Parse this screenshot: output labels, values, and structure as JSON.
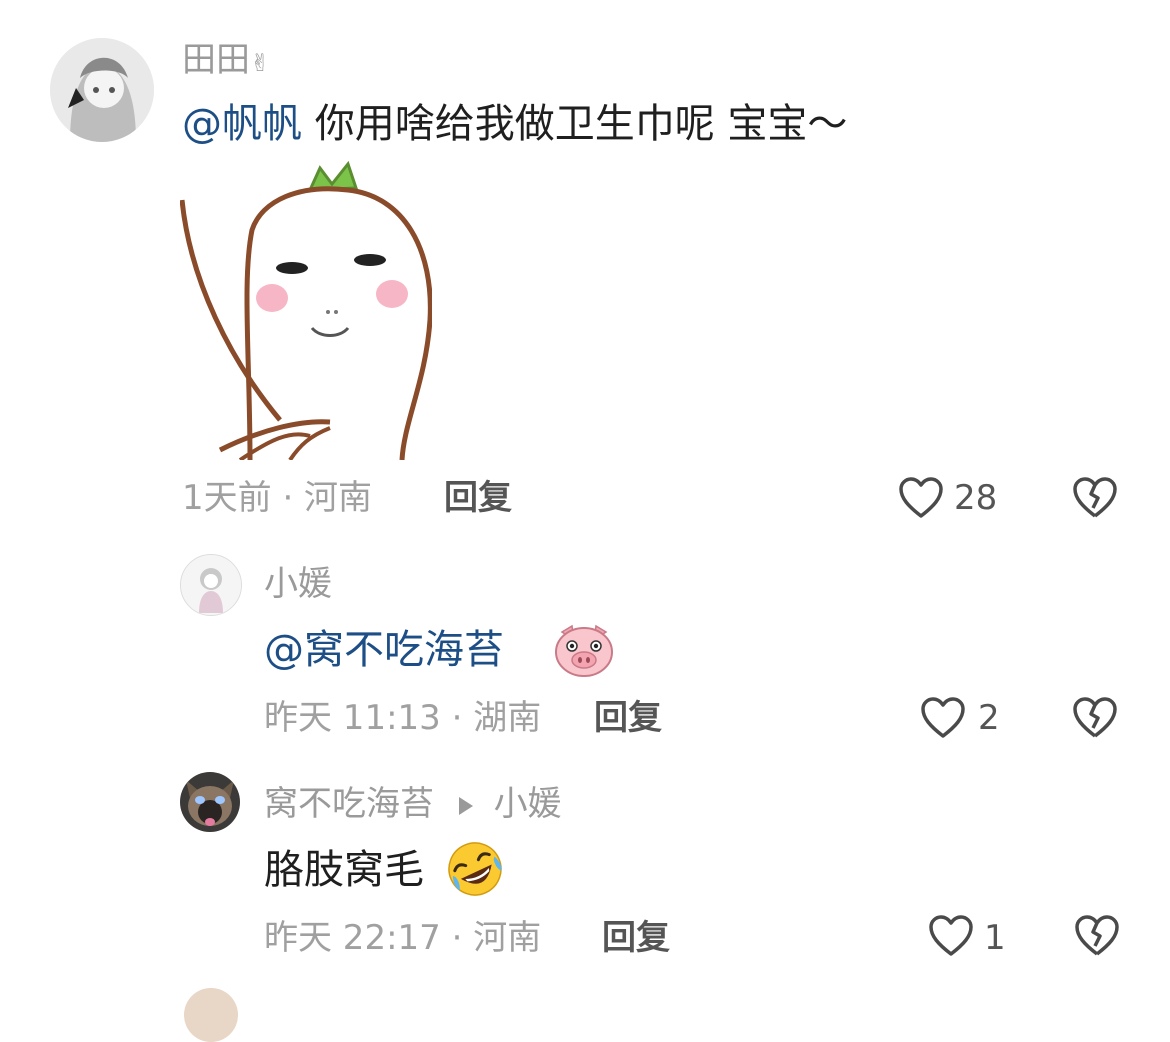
{
  "comments": [
    {
      "user": "田田",
      "user_emoji": "✌",
      "mention": "@帆帆",
      "text": "你用啥给我做卫生巾呢 宝宝～",
      "meta": "1天前 · 河南",
      "reply_label": "回复",
      "likes": "28"
    },
    {
      "user": "小媛",
      "mention": "@窝不吃海苔",
      "emoji": "pig-face",
      "meta": "昨天 11:13 · 湖南",
      "reply_label": "回复",
      "likes": "2"
    },
    {
      "user": "窝不吃海苔",
      "reply_to": "小媛",
      "text": "胳肢窝毛",
      "emoji": "rolling-on-floor-laughing",
      "meta": "昨天 22:17 · 河南",
      "reply_label": "回复",
      "likes": "1"
    }
  ],
  "colors": {
    "mention": "#1d4f86",
    "meta": "#a0a0a0",
    "name": "#9a9a9a"
  }
}
